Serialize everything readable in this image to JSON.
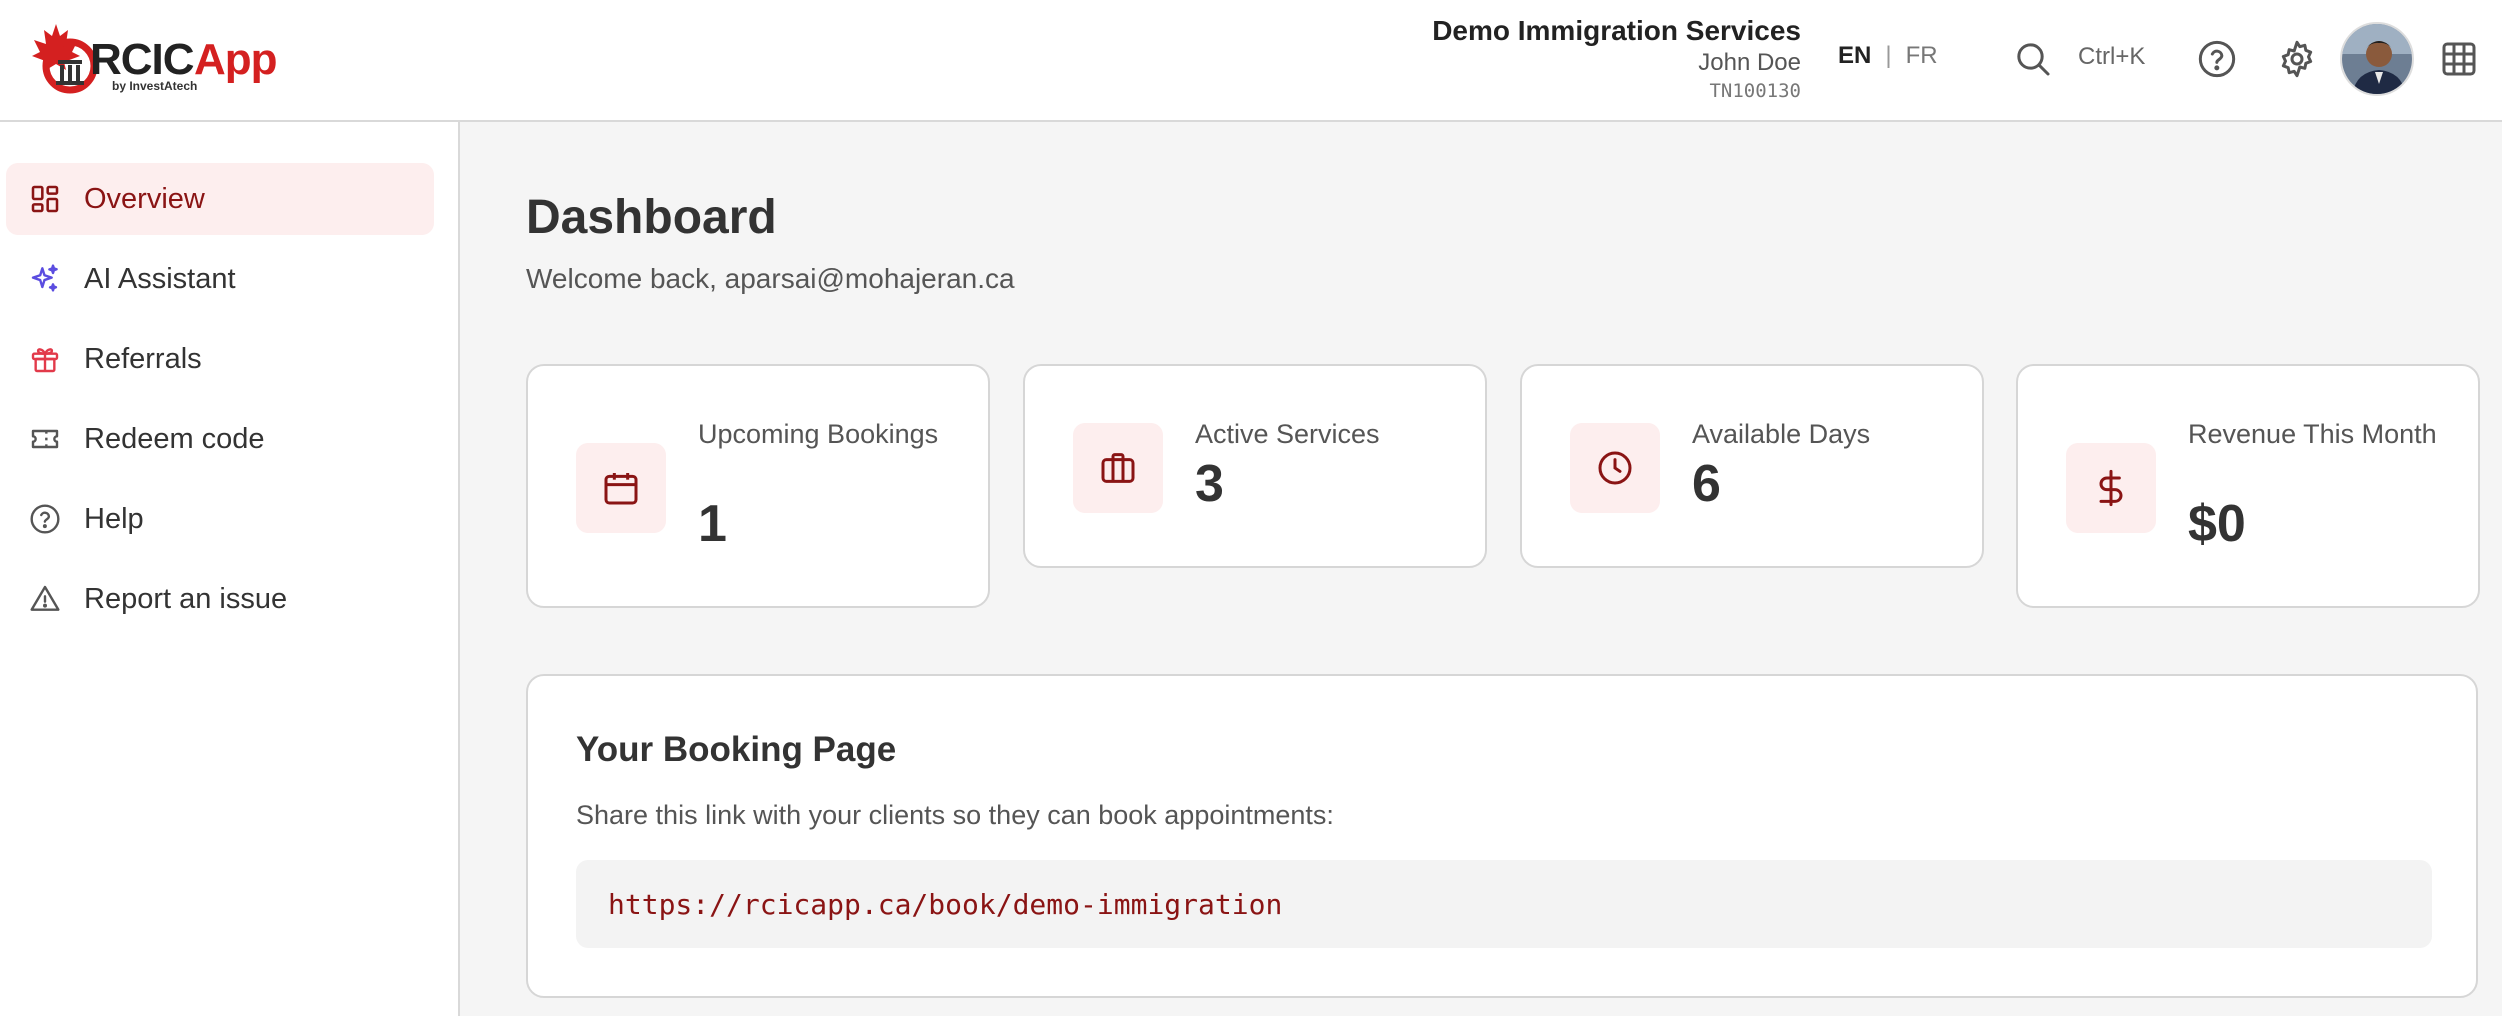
{
  "header": {
    "logo": {
      "text": "RCICApp",
      "byline": "by InvestAtech"
    },
    "org_name": "Demo Immigration Services",
    "user_name": "John Doe",
    "user_id": "TN100130",
    "languages": {
      "active": "EN",
      "separator": "|",
      "other": "FR"
    },
    "search_shortcut": "Ctrl+K",
    "icons": [
      "search-icon",
      "help-icon",
      "gear-icon",
      "grid-icon"
    ]
  },
  "sidebar": {
    "items": [
      {
        "label": "Overview",
        "icon": "overview-icon",
        "active": true
      },
      {
        "label": "AI Assistant",
        "icon": "sparkles-icon",
        "active": false
      },
      {
        "label": "Referrals",
        "icon": "gift-icon",
        "active": false
      },
      {
        "label": "Redeem code",
        "icon": "ticket-icon",
        "active": false
      },
      {
        "label": "Help",
        "icon": "help-icon",
        "active": false
      },
      {
        "label": "Report an issue",
        "icon": "warning-icon",
        "active": false
      }
    ]
  },
  "main": {
    "title": "Dashboard",
    "welcome": "Welcome back, aparsai@mohajeran.ca",
    "stats": [
      {
        "label": "Upcoming Bookings",
        "value": "1",
        "icon": "calendar-icon"
      },
      {
        "label": "Active Services",
        "value": "3",
        "icon": "briefcase-icon"
      },
      {
        "label": "Available Days",
        "value": "6",
        "icon": "clock-icon"
      },
      {
        "label": "Revenue This Month",
        "value": "$0",
        "icon": "dollar-icon"
      }
    ],
    "booking": {
      "title": "Your Booking Page",
      "description": "Share this link with your clients so they can book appointments:",
      "url": "https://rcicapp.ca/book/demo-immigration"
    }
  },
  "colors": {
    "brand_red": "#8a1414",
    "active_bg": "#fdeeee",
    "ai_accent": "#5b4de0",
    "referral_red": "#e23a4a"
  }
}
